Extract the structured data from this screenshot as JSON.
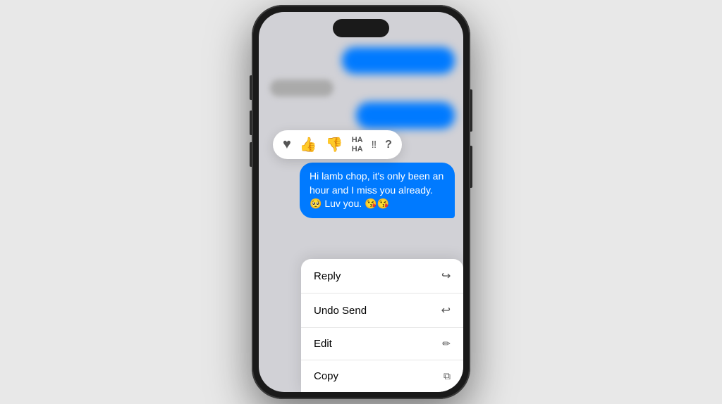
{
  "phone": {
    "screen_bg": "#d1d1d6"
  },
  "reactions": {
    "items": [
      {
        "id": "heart",
        "symbol": "♥",
        "label": "heart"
      },
      {
        "id": "thumbs-up",
        "symbol": "👍",
        "label": "thumbs up"
      },
      {
        "id": "thumbs-down",
        "symbol": "👎",
        "label": "thumbs down"
      },
      {
        "id": "haha",
        "symbol": "HA\nHA",
        "label": "haha"
      },
      {
        "id": "exclamation",
        "symbol": "‼",
        "label": "emphasis"
      },
      {
        "id": "question",
        "symbol": "?",
        "label": "question"
      }
    ]
  },
  "message": {
    "text": "Hi lamb chop, it's only been an hour and I miss you already. 🥺 Luv you. 😘😘"
  },
  "context_menu": {
    "items": [
      {
        "id": "reply",
        "label": "Reply",
        "icon": "↩"
      },
      {
        "id": "undo-send",
        "label": "Undo Send",
        "icon": "↩"
      },
      {
        "id": "edit",
        "label": "Edit",
        "icon": "✏"
      },
      {
        "id": "copy",
        "label": "Copy",
        "icon": "⧉"
      }
    ]
  }
}
